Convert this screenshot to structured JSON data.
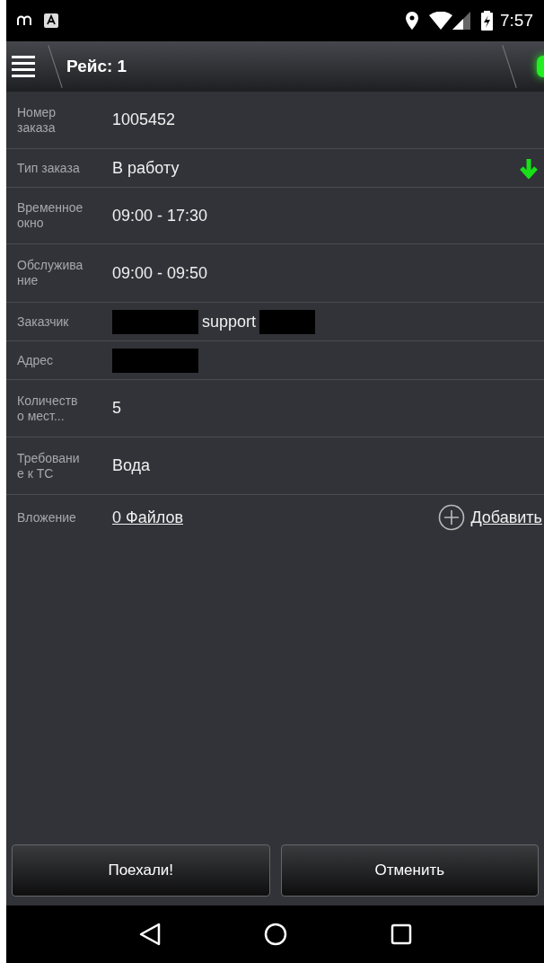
{
  "status_bar": {
    "time": "7:57"
  },
  "toolbar": {
    "title": "Рейс: 1"
  },
  "fields": [
    {
      "label": "Номер\nзаказа",
      "kind": "text",
      "segments": [
        {
          "kind": "text",
          "text": "1005452"
        }
      ]
    },
    {
      "label": "Тип заказа",
      "kind": "dropdown",
      "segments": [
        {
          "kind": "text",
          "text": "В работу"
        }
      ]
    },
    {
      "label": "Временное\nокно",
      "kind": "text",
      "segments": [
        {
          "kind": "text",
          "text": "09:00 - 17:30"
        }
      ]
    },
    {
      "label": "Обслужива\nние",
      "kind": "text",
      "segments": [
        {
          "kind": "text",
          "text": "09:00 - 09:50"
        }
      ]
    },
    {
      "label": "Заказчик",
      "kind": "text",
      "segments": [
        {
          "kind": "redacted"
        },
        {
          "kind": "text",
          "text": "support"
        },
        {
          "kind": "redacted"
        }
      ]
    },
    {
      "label": "Адрес",
      "kind": "text",
      "segments": [
        {
          "kind": "redacted"
        }
      ]
    },
    {
      "label": "Количеств\nо мест...",
      "kind": "text",
      "segments": [
        {
          "kind": "text",
          "text": "5"
        }
      ]
    },
    {
      "label": "Требовани\nе к ТС",
      "kind": "text",
      "segments": [
        {
          "kind": "text",
          "text": "Вода"
        }
      ]
    }
  ],
  "attachment": {
    "label": "Вложение",
    "files_link": "0 Файлов",
    "add_link": "Добавить"
  },
  "buttons": [
    "Поехали!",
    "Отменить"
  ]
}
